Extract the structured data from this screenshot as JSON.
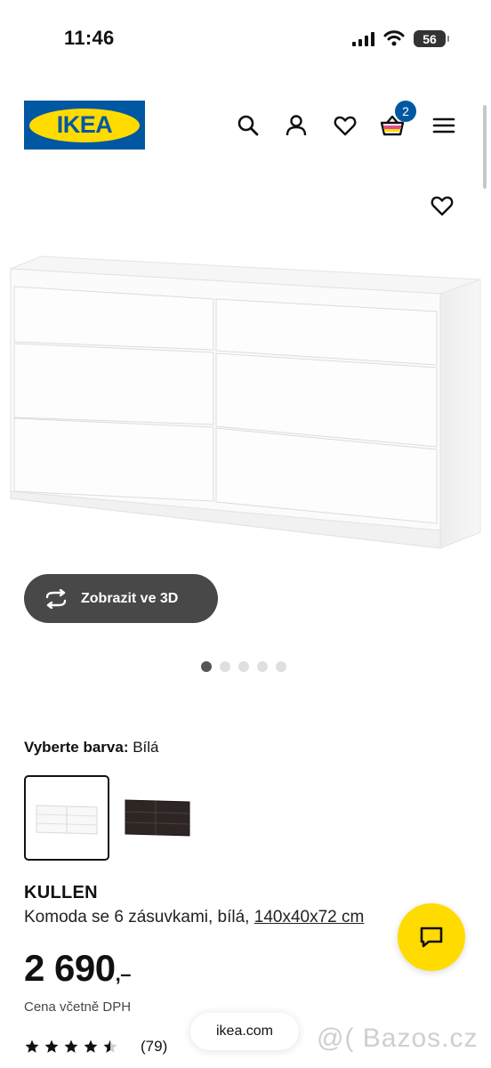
{
  "status_bar": {
    "time": "11:46",
    "battery": "56"
  },
  "header": {
    "logo_text": "IKEA",
    "cart_count": "2"
  },
  "gallery": {
    "view_3d_label": "Zobrazit ve 3D",
    "dots_total": 5,
    "active_dot": 0
  },
  "color": {
    "label": "Vyberte barva:",
    "value": "Bílá",
    "options": [
      "white",
      "black-brown"
    ]
  },
  "product": {
    "name": "KULLEN",
    "description": "Komoda se 6 zásuvkami, bílá,",
    "dimensions": "140x40x72 cm",
    "price": "2 690",
    "price_suffix": ",–",
    "price_note": "Cena včetně DPH",
    "rating": 4.5,
    "rating_count": "(79)"
  },
  "browser": {
    "url": "ikea.com"
  },
  "watermark": "@( Bazos.cz",
  "colors": {
    "ikea_blue": "#0058a3",
    "ikea_yellow": "#ffdb00",
    "button_dark": "#484848"
  }
}
